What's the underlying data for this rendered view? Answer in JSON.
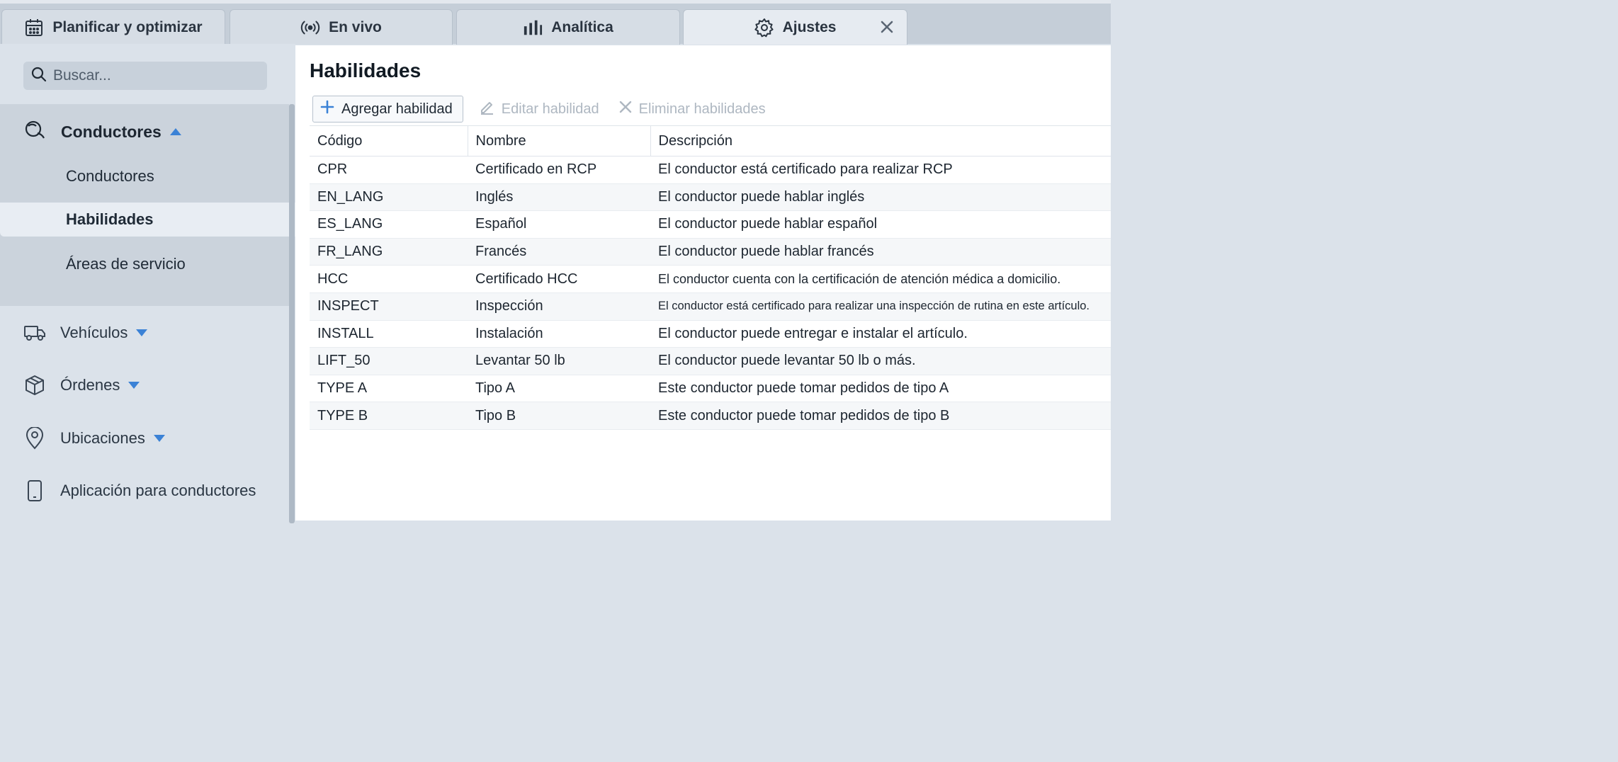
{
  "tabs": [
    {
      "label": "Planificar y optimizar",
      "icon": "calendar-icon",
      "active": false
    },
    {
      "label": "En vivo",
      "icon": "broadcast-icon",
      "active": false
    },
    {
      "label": "Analítica",
      "icon": "bar-chart-icon",
      "active": false
    },
    {
      "label": "Ajustes",
      "icon": "gear-icon",
      "active": true
    }
  ],
  "sidebar": {
    "search_placeholder": "Buscar...",
    "group": {
      "label": "Conductores",
      "icon": "drivers-icon",
      "items": [
        {
          "label": "Conductores",
          "selected": false
        },
        {
          "label": "Habilidades",
          "selected": true
        },
        {
          "label": "Áreas de servicio",
          "selected": false
        }
      ]
    },
    "nav": [
      {
        "label": "Vehículos",
        "icon": "truck-icon",
        "caret": true
      },
      {
        "label": "Órdenes",
        "icon": "box-icon",
        "caret": true
      },
      {
        "label": "Ubicaciones",
        "icon": "location-pin-icon",
        "caret": true
      },
      {
        "label": "Aplicación para conductores",
        "icon": "phone-icon",
        "caret": false
      }
    ]
  },
  "main": {
    "title": "Habilidades",
    "toolbar": {
      "add": "Agregar habilidad",
      "edit": "Editar habilidad",
      "delete": "Eliminar habilidades"
    },
    "table": {
      "columns": [
        "Código",
        "Nombre",
        "Descripción"
      ],
      "rows": [
        [
          "CPR",
          "Certificado en RCP",
          "El conductor está certificado para realizar RCP"
        ],
        [
          "EN_LANG",
          "Inglés",
          "El conductor puede hablar inglés"
        ],
        [
          "ES_LANG",
          "Español",
          "El conductor puede hablar español"
        ],
        [
          "FR_LANG",
          "Francés",
          "El conductor puede hablar francés"
        ],
        [
          "HCC",
          "Certificado HCC",
          "El conductor cuenta con la certificación de atención médica a domicilio."
        ],
        [
          "INSPECT",
          "Inspección",
          "El conductor está certificado para realizar una inspección de rutina en este artículo."
        ],
        [
          "INSTALL",
          "Instalación",
          "El conductor puede entregar e instalar el artículo."
        ],
        [
          "LIFT_50",
          "Levantar 50 lb",
          "El conductor puede levantar 50 lb o más."
        ],
        [
          "TYPE A",
          "Tipo A",
          "Este conductor puede tomar pedidos de tipo A"
        ],
        [
          "TYPE B",
          "Tipo B",
          "Este conductor puede tomar pedidos de tipo B"
        ]
      ]
    }
  },
  "colors": {
    "accent": "#3b82d6",
    "sidebar_bg": "#dbe2ea",
    "selected_bg": "#e8edf3"
  }
}
